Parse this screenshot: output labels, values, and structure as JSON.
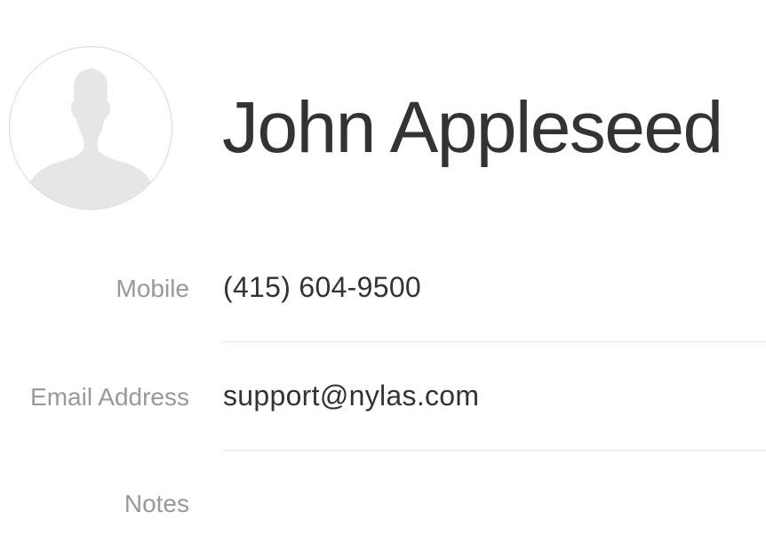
{
  "contact": {
    "name": "John Appleseed",
    "avatar_icon": "person-silhouette-icon"
  },
  "fields": {
    "mobile": {
      "label": "Mobile",
      "value": "(415) 604-9500"
    },
    "email": {
      "label": "Email Address",
      "value": "support@nylas.com"
    },
    "notes": {
      "label": "Notes",
      "value": ""
    }
  },
  "colors": {
    "name_text": "#333333",
    "label_text": "#999999",
    "value_text": "#333333",
    "divider": "#e5e5e5",
    "avatar_fill": "#e6e6e6",
    "avatar_border": "#d8d8d8"
  }
}
